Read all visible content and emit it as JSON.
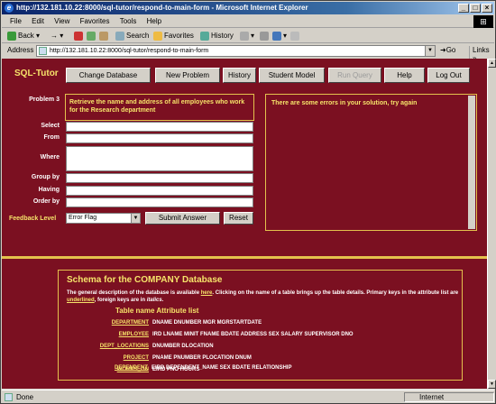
{
  "window": {
    "title": "http://132.181.10.22:8000/sql-tutor/respond-to-main-form - Microsoft Internet Explorer"
  },
  "menu": [
    "File",
    "Edit",
    "View",
    "Favorites",
    "Tools",
    "Help"
  ],
  "toolbar": {
    "back": "Back",
    "search": "Search",
    "favorites": "Favorites",
    "history": "History"
  },
  "address": {
    "label": "Address",
    "url": "http://132.181.10.22:8000/sql-tutor/respond-to-main-form",
    "go": "Go",
    "links": "Links"
  },
  "app": {
    "logo": "SQL-Tutor",
    "nav": [
      "Change Database",
      "New Problem",
      "History",
      "Student Model",
      "Run Query",
      "Help",
      "Log Out"
    ],
    "problem_label": "Problem 3",
    "problem_text": "Retrieve the name and address of all employees who work for the Research department",
    "feedback_text": "There are some errors in your solution, try again",
    "clauses": [
      "Select",
      "From",
      "Where",
      "Group by",
      "Having",
      "Order by"
    ],
    "feedback_label": "Feedback Level",
    "feedback_level": "Error Flag",
    "submit": "Submit Answer",
    "reset": "Reset"
  },
  "schema": {
    "title": "Schema for the COMPANY Database",
    "desc_a": "The general description of the database is available ",
    "desc_link": "here",
    "desc_b": ". Clicking on the name of a table brings up the table details. Primary keys in the attribute list are ",
    "desc_ul": "underlined",
    "desc_c": ", foreign keys are in ",
    "desc_it": "italics",
    "desc_d": ".",
    "header": "Table name Attribute list",
    "tables": [
      {
        "name": "DEPARTMENT",
        "attrs": "DNAME DNUMBER MGR MGRSTARTDATE"
      },
      {
        "name": "EMPLOYEE",
        "attrs": "IRD LNAME MINIT FNAME BDATE ADDRESS SEX SALARY SUPERVISOR DNO"
      },
      {
        "name": "DEPT_LOCATIONS",
        "attrs": "DNUMBER DLOCATION"
      },
      {
        "name": "PROJECT",
        "attrs": "PNAME PNUMBER PLOCATION DNUM"
      },
      {
        "name": "WORKS_ON",
        "attrs": "EIRD PNO HOURS"
      },
      {
        "name": "DEPENDENT",
        "attrs": "EIRD DEPENDENT_NAME SEX BDATE RELATIONSHIP"
      }
    ]
  },
  "status": {
    "left": "Done",
    "zone": "Internet"
  }
}
